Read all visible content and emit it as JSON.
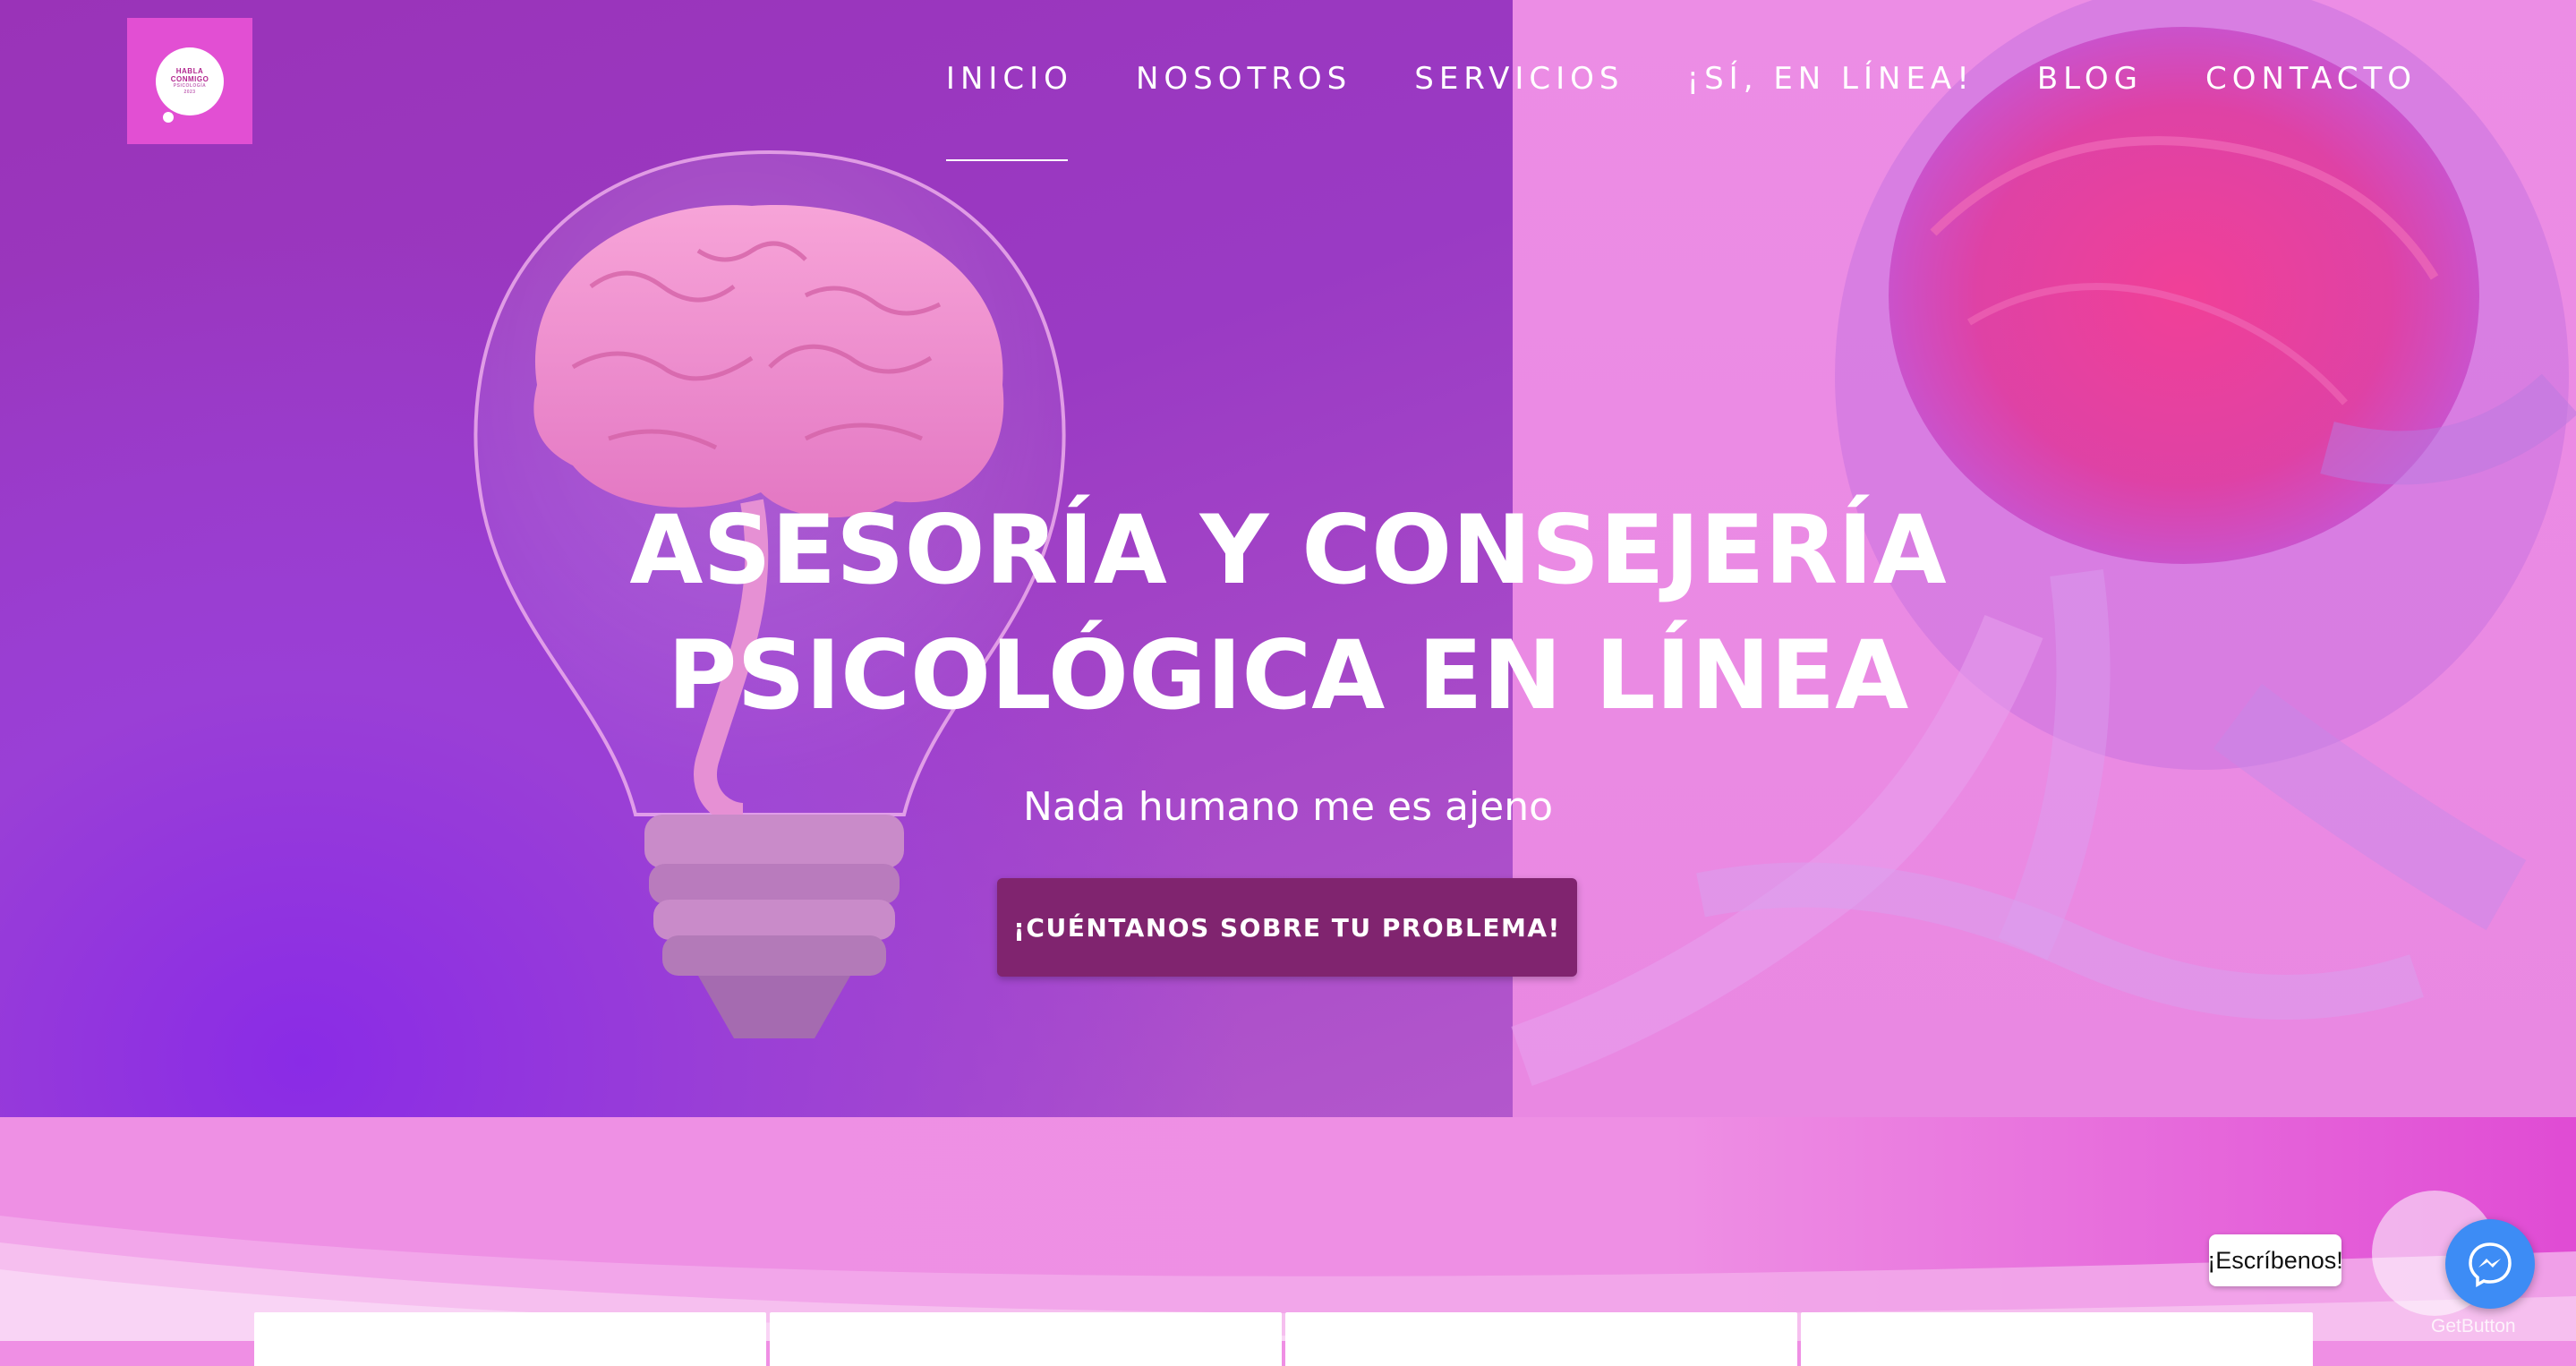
{
  "logo": {
    "line1": "HABLA",
    "line2": "CONMIGO",
    "line3": "PSICOLOGÍA",
    "line4": "2023"
  },
  "nav": {
    "items": [
      {
        "label": "INICIO",
        "active": true
      },
      {
        "label": "NOSOTROS"
      },
      {
        "label": "SERVICIOS"
      },
      {
        "label": "¡SÍ, EN LÍNEA!"
      },
      {
        "label": "BLOG"
      },
      {
        "label": "CONTACTO"
      }
    ]
  },
  "hero": {
    "title": "ASESORÍA Y CONSEJERÍA PSICOLÓGICA EN LÍNEA",
    "subtitle": "Nada humano me es ajeno",
    "cta_label": "¡CUÉNTANOS SOBRE TU PROBLEMA!"
  },
  "chat": {
    "label": "¡Escríbenos!",
    "icon": "messenger-icon",
    "brand": "GetButton"
  },
  "colors": {
    "accent": "#e24fd3",
    "cta": "#80246f",
    "messenger": "#3d8cf5"
  }
}
